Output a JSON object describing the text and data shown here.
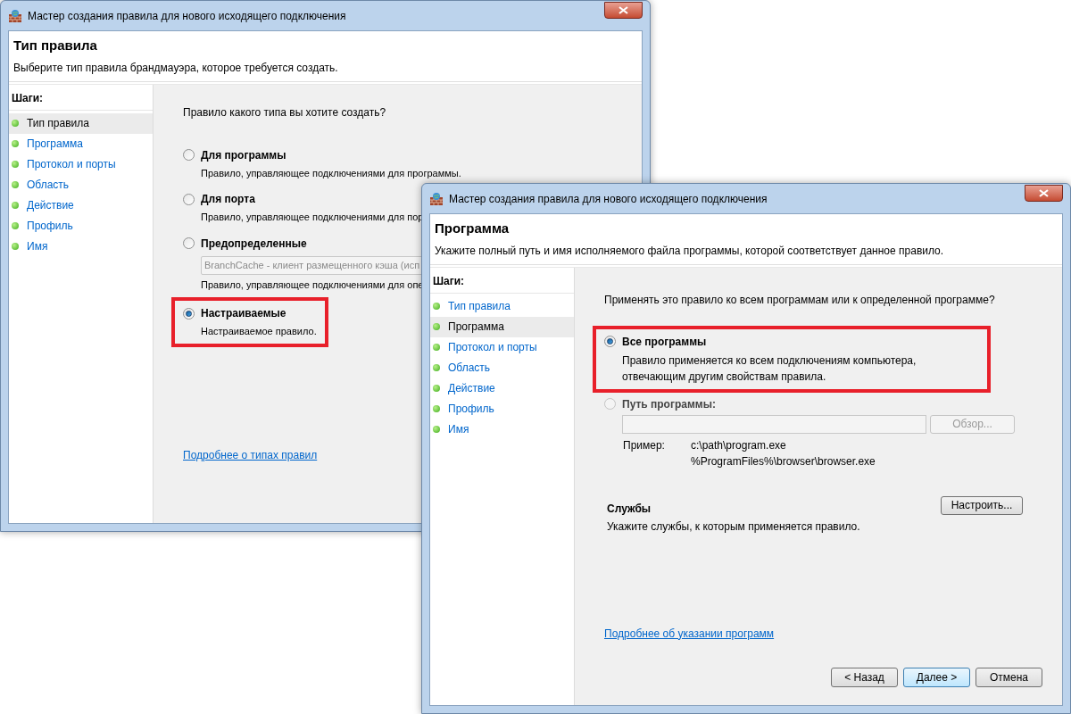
{
  "windows": [
    {
      "kind": "rule_type",
      "title": "Мастер создания правила для нового исходящего подключения",
      "header": {
        "title": "Тип правила",
        "subtitle": "Выберите тип правила брандмауэра, которое требуется создать."
      },
      "steps_heading": "Шаги:",
      "steps": [
        {
          "label": "Тип правила",
          "selected": true
        },
        {
          "label": "Программа",
          "selected": false
        },
        {
          "label": "Протокол и порты",
          "selected": false
        },
        {
          "label": "Область",
          "selected": false
        },
        {
          "label": "Действие",
          "selected": false
        },
        {
          "label": "Профиль",
          "selected": false
        },
        {
          "label": "Имя",
          "selected": false
        }
      ],
      "question": "Правило какого типа вы хотите создать?",
      "options": [
        {
          "label": "Для программы",
          "description": "Правило, управляющее подключениями для программы.",
          "selected": false,
          "highlighted": false
        },
        {
          "label": "Для порта",
          "description": "Правило, управляющее подключениями для пор",
          "selected": false,
          "highlighted": false
        },
        {
          "label": "Предопределенные",
          "dropdown": "BranchCache - клиент размещенного кэша (исп",
          "description": "Правило, управляющее подключениями для опе",
          "selected": false,
          "highlighted": false
        },
        {
          "label": "Настраиваемые",
          "description": "Настраиваемое правило.",
          "selected": true,
          "highlighted": true
        }
      ],
      "link": "Подробнее о типах правил"
    },
    {
      "kind": "program",
      "title": "Мастер создания правила для нового исходящего подключения",
      "header": {
        "title": "Программа",
        "subtitle": "Укажите полный путь и имя исполняемого файла программы, которой соответствует данное правило."
      },
      "steps_heading": "Шаги:",
      "steps": [
        {
          "label": "Тип правила",
          "selected": false
        },
        {
          "label": "Программа",
          "selected": true
        },
        {
          "label": "Протокол и порты",
          "selected": false
        },
        {
          "label": "Область",
          "selected": false
        },
        {
          "label": "Действие",
          "selected": false
        },
        {
          "label": "Профиль",
          "selected": false
        },
        {
          "label": "Имя",
          "selected": false
        }
      ],
      "question": "Применять это правило ко всем программам или к определенной программе?",
      "options": [
        {
          "label": "Все программы",
          "description": "Правило применяется ко всем подключениям компьютера, отвечающим другим свойствам правила.",
          "selected": true,
          "highlighted": true,
          "disabled": false
        },
        {
          "label": "Путь программы:",
          "selected": false,
          "highlighted": false,
          "disabled": true,
          "browse_button": "Обзор...",
          "example": {
            "label": "Пример:",
            "lines": [
              "c:\\path\\program.exe",
              "%ProgramFiles%\\browser\\browser.exe"
            ]
          }
        }
      ],
      "services": {
        "title": "Службы",
        "description": "Укажите службы, к которым применяется правило.",
        "button": "Настроить..."
      },
      "link": "Подробнее об указании программ",
      "buttons": [
        {
          "label": "< Назад",
          "default": false
        },
        {
          "label": "Далее >",
          "default": true
        },
        {
          "label": "Отмена",
          "default": false
        }
      ]
    }
  ]
}
